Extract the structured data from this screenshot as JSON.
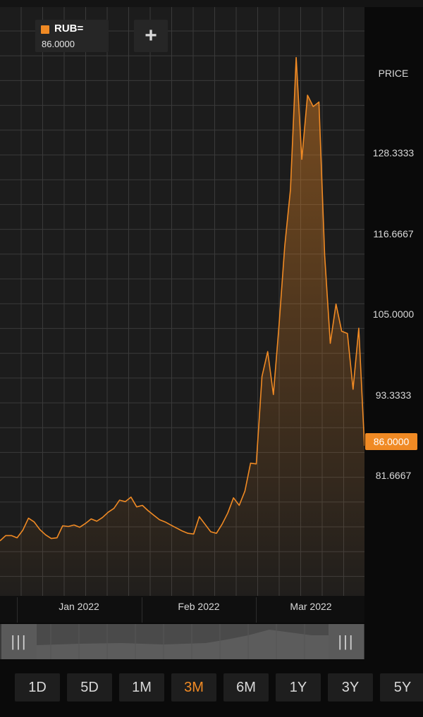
{
  "legend": {
    "symbol": "RUB=",
    "price": "86.0000",
    "add_label": "+"
  },
  "axis": {
    "title": "PRICE",
    "y_ticks": [
      "128.3333",
      "116.6667",
      "105.0000",
      "93.3333",
      "81.6667"
    ],
    "last_price": "86.0000",
    "x_ticks": [
      "Jan 2022",
      "Feb 2022",
      "Mar 2022"
    ]
  },
  "ranges": [
    {
      "label": "1D",
      "active": false
    },
    {
      "label": "5D",
      "active": false
    },
    {
      "label": "1M",
      "active": false
    },
    {
      "label": "3M",
      "active": true
    },
    {
      "label": "6M",
      "active": false
    },
    {
      "label": "1Y",
      "active": false
    },
    {
      "label": "3Y",
      "active": false
    },
    {
      "label": "5Y",
      "active": false
    }
  ],
  "colors": {
    "accent": "#f08a24",
    "grid": "#3a3a3a",
    "panel": "#1c1c1c"
  },
  "chart_data": {
    "type": "area",
    "x": [
      "2021-12-14",
      "2021-12-15",
      "2021-12-16",
      "2021-12-17",
      "2021-12-20",
      "2021-12-21",
      "2021-12-22",
      "2021-12-23",
      "2021-12-24",
      "2021-12-27",
      "2021-12-28",
      "2021-12-29",
      "2021-12-30",
      "2021-12-31",
      "2022-01-03",
      "2022-01-04",
      "2022-01-05",
      "2022-01-06",
      "2022-01-07",
      "2022-01-10",
      "2022-01-11",
      "2022-01-12",
      "2022-01-13",
      "2022-01-14",
      "2022-01-17",
      "2022-01-18",
      "2022-01-19",
      "2022-01-20",
      "2022-01-21",
      "2022-01-24",
      "2022-01-25",
      "2022-01-26",
      "2022-01-27",
      "2022-01-28",
      "2022-01-31",
      "2022-02-01",
      "2022-02-02",
      "2022-02-03",
      "2022-02-04",
      "2022-02-07",
      "2022-02-08",
      "2022-02-09",
      "2022-02-10",
      "2022-02-11",
      "2022-02-14",
      "2022-02-15",
      "2022-02-16",
      "2022-02-17",
      "2022-02-18",
      "2022-02-21",
      "2022-02-22",
      "2022-02-23",
      "2022-02-24",
      "2022-02-25",
      "2022-02-28",
      "2022-03-01",
      "2022-03-02",
      "2022-03-03",
      "2022-03-04",
      "2022-03-07",
      "2022-03-08",
      "2022-03-09",
      "2022-03-10",
      "2022-03-11",
      "2022-03-14"
    ],
    "values": [
      73.4,
      74.1,
      74.1,
      73.8,
      74.8,
      76.4,
      75.9,
      74.9,
      74.2,
      73.7,
      73.8,
      75.4,
      75.3,
      75.5,
      75.2,
      75.7,
      76.3,
      76.0,
      76.5,
      77.2,
      77.7,
      78.8,
      78.6,
      79.2,
      77.9,
      78.1,
      77.4,
      76.8,
      76.2,
      75.9,
      75.5,
      75.1,
      74.7,
      74.4,
      74.3,
      76.6,
      75.6,
      74.6,
      74.4,
      75.6,
      77.1,
      79.1,
      78.1,
      80.0,
      83.7,
      83.6,
      95.2,
      98.5,
      92.8,
      102.0,
      112.5,
      120.0,
      137.5,
      124.0,
      132.5,
      131.0,
      131.6,
      111.3,
      99.6,
      104.8,
      101.2,
      100.9,
      93.5,
      101.6,
      86.0
    ],
    "ylim": [
      66.1,
      144.2
    ],
    "y_ticks": [
      81.6667,
      93.3333,
      105.0,
      116.6667,
      128.3333
    ],
    "x_ticks": [
      "Jan 2022",
      "Feb 2022",
      "Mar 2022"
    ],
    "ylabel": "PRICE",
    "grid": true,
    "series_color": "#f08a24"
  }
}
